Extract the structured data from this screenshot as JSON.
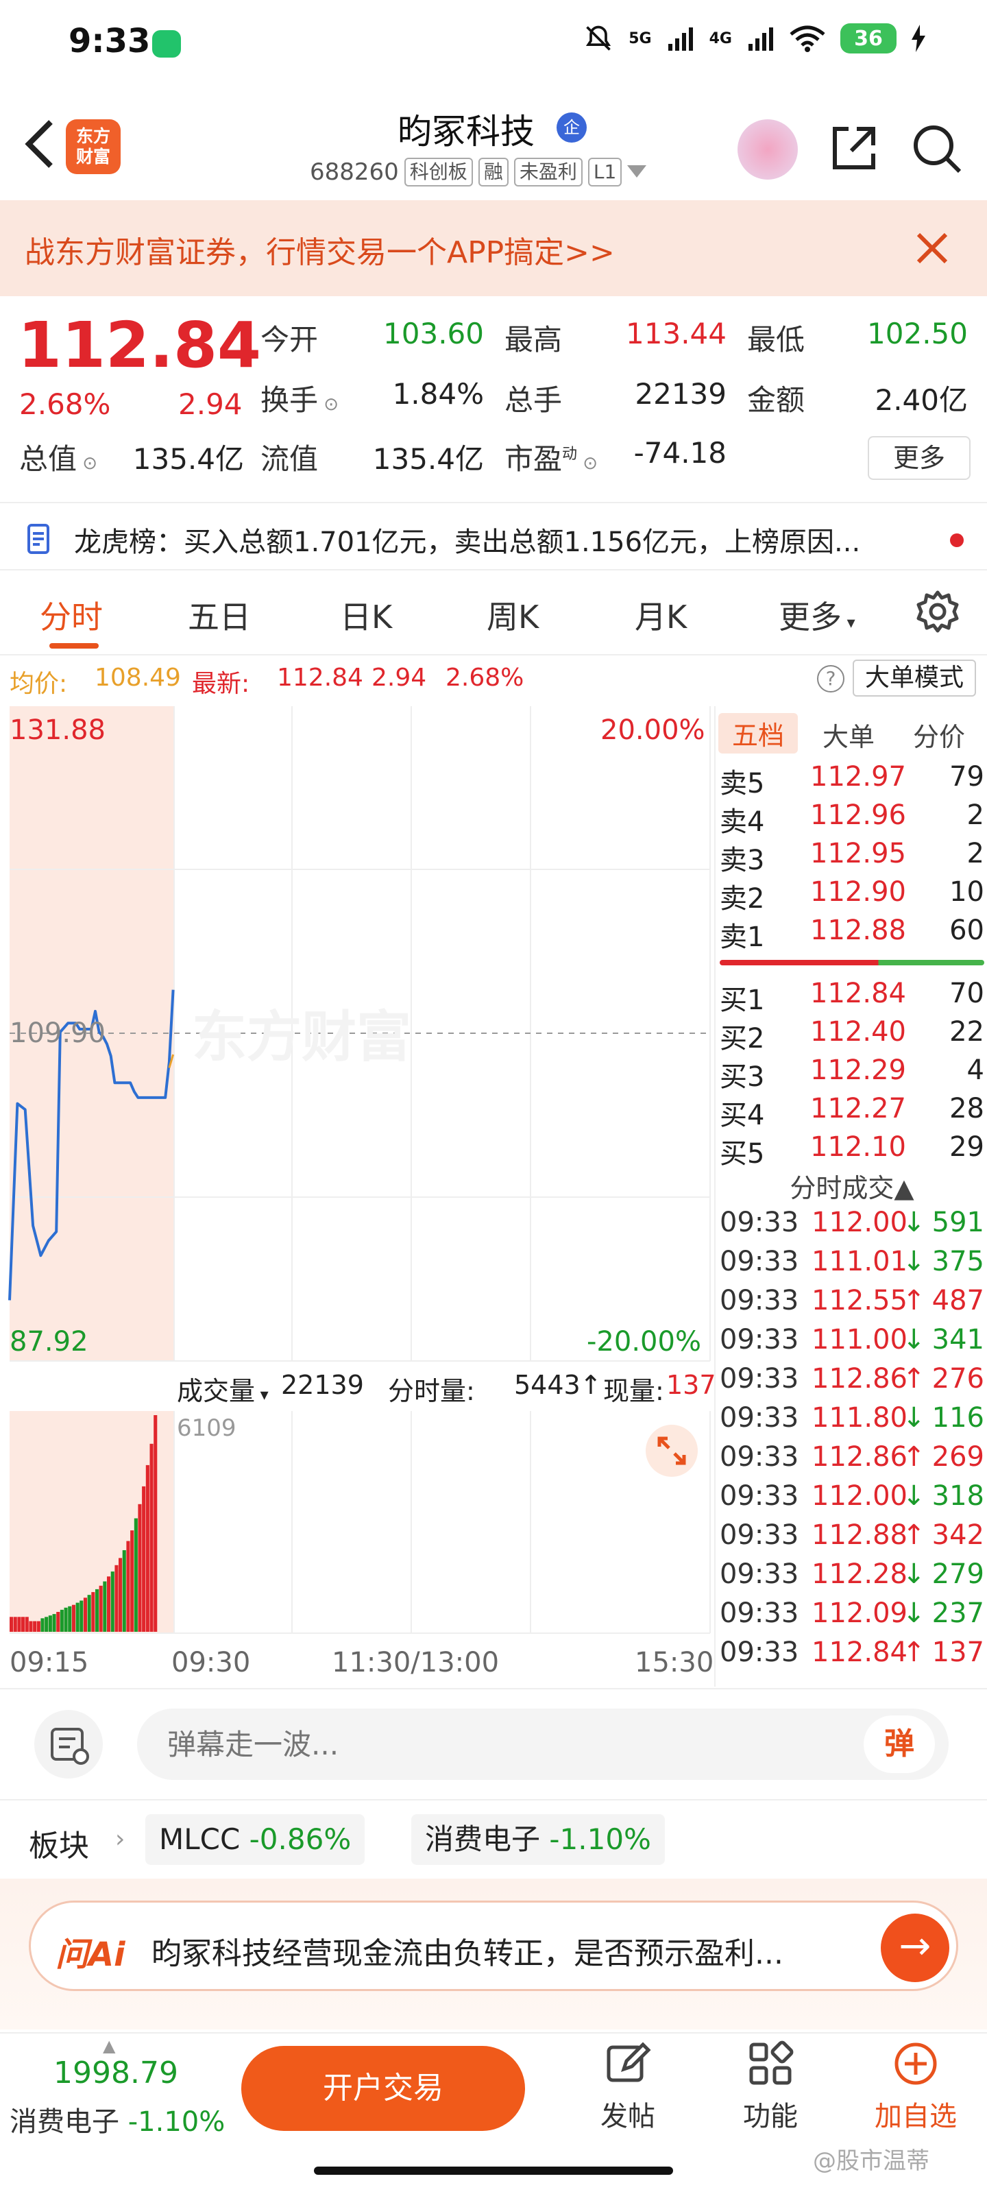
{
  "status": {
    "time": "9:33",
    "signal_5g": "5G",
    "signal_4g": "4G",
    "battery": "36"
  },
  "header": {
    "logo_line1": "东方",
    "logo_line2": "财富",
    "title": "昀冢科技",
    "qi_badge": "企",
    "code": "688260",
    "tags": [
      "科创板",
      "融",
      "未盈利",
      "L1"
    ]
  },
  "promo": {
    "text": "战东方财富证券，行情交易一个APP搞定>>"
  },
  "quote": {
    "last": "112.84",
    "change_pct": "2.68%",
    "change_amt": "2.94",
    "open_label": "今开",
    "open": "103.60",
    "high_label": "最高",
    "high": "113.44",
    "low_label": "最低",
    "low": "102.50",
    "turnover_label": "换手",
    "turnover": "1.84%",
    "volume_label": "总手",
    "volume": "22139",
    "amount_label": "金额",
    "amount": "2.40亿",
    "mktcap_label": "总值",
    "mktcap": "135.4亿",
    "float_label": "流值",
    "float": "135.4亿",
    "pe_label": "市盈",
    "pe_sup": "动",
    "pe": "-74.18",
    "more": "更多"
  },
  "dragon": {
    "text": "龙虎榜：买入总额1.701亿元，卖出总额1.156亿元，上榜原因..."
  },
  "tabs": [
    "分时",
    "五日",
    "日K",
    "周K",
    "月K",
    "更多"
  ],
  "info_line": {
    "avg_label": "均价:",
    "avg": "108.49",
    "latest_label": "最新:",
    "latest": "112.84",
    "chg": "2.94",
    "pct": "2.68%",
    "help": "?",
    "big_order": "大单模式"
  },
  "chart_labels": {
    "top_price": "131.88",
    "top_pct": "20.00%",
    "mid_price": "109.90",
    "bottom_price": "87.92",
    "bottom_pct": "-20.00%",
    "watermark": "东方财富",
    "vol_max": "6109",
    "times": [
      "09:15",
      "09:30",
      "11:30/13:00",
      "15:30"
    ]
  },
  "volume_bar": {
    "vol_label": "成交量",
    "vol": "22139",
    "minute_label": "分时量:",
    "minute": "5443",
    "now_label": "现量:",
    "now": "137"
  },
  "chart_data": {
    "type": "line",
    "ylim": [
      87.92,
      131.88
    ],
    "price_x": [
      0,
      2,
      3,
      4,
      6,
      8,
      10,
      12,
      13,
      15,
      16,
      17,
      18,
      19,
      20,
      21,
      22,
      23,
      24,
      25,
      26,
      27,
      28,
      29,
      30,
      31,
      32,
      33,
      34,
      35,
      36,
      37,
      38,
      39,
      40,
      41,
      42
    ],
    "price_y": [
      92.0,
      105.2,
      105.0,
      104.8,
      97.0,
      95.0,
      96.0,
      96.6,
      110.0,
      110.6,
      110.6,
      110.6,
      110.2,
      110.2,
      110.2,
      110.2,
      111.4,
      110.0,
      109.7,
      109.2,
      108.4,
      106.6,
      106.6,
      106.6,
      106.6,
      106.6,
      106.0,
      105.6,
      105.6,
      105.6,
      105.6,
      105.6,
      105.6,
      105.6,
      105.6,
      108.0,
      112.84
    ],
    "avg_x": [
      41,
      42
    ],
    "avg_y": [
      107.6,
      108.49
    ],
    "volume": [
      {
        "x": 0,
        "v": 420,
        "c": "red"
      },
      {
        "x": 1,
        "v": 420,
        "c": "red"
      },
      {
        "x": 2,
        "v": 420,
        "c": "red"
      },
      {
        "x": 3,
        "v": 420,
        "c": "red"
      },
      {
        "x": 4,
        "v": 420,
        "c": "red"
      },
      {
        "x": 5,
        "v": 300,
        "c": "red"
      },
      {
        "x": 6,
        "v": 300,
        "c": "red"
      },
      {
        "x": 7,
        "v": 300,
        "c": "red"
      },
      {
        "x": 8,
        "v": 380,
        "c": "green"
      },
      {
        "x": 9,
        "v": 420,
        "c": "green"
      },
      {
        "x": 10,
        "v": 460,
        "c": "green"
      },
      {
        "x": 11,
        "v": 500,
        "c": "green"
      },
      {
        "x": 12,
        "v": 560,
        "c": "red"
      },
      {
        "x": 13,
        "v": 620,
        "c": "green"
      },
      {
        "x": 14,
        "v": 680,
        "c": "green"
      },
      {
        "x": 15,
        "v": 720,
        "c": "green"
      },
      {
        "x": 16,
        "v": 760,
        "c": "red"
      },
      {
        "x": 17,
        "v": 820,
        "c": "green"
      },
      {
        "x": 18,
        "v": 880,
        "c": "green"
      },
      {
        "x": 19,
        "v": 960,
        "c": "red"
      },
      {
        "x": 20,
        "v": 1040,
        "c": "green"
      },
      {
        "x": 21,
        "v": 1120,
        "c": "red"
      },
      {
        "x": 22,
        "v": 1200,
        "c": "green"
      },
      {
        "x": 23,
        "v": 1300,
        "c": "red"
      },
      {
        "x": 24,
        "v": 1420,
        "c": "green"
      },
      {
        "x": 25,
        "v": 1560,
        "c": "red"
      },
      {
        "x": 26,
        "v": 1700,
        "c": "green"
      },
      {
        "x": 27,
        "v": 1880,
        "c": "red"
      },
      {
        "x": 28,
        "v": 2080,
        "c": "red"
      },
      {
        "x": 29,
        "v": 2300,
        "c": "green"
      },
      {
        "x": 30,
        "v": 2560,
        "c": "red"
      },
      {
        "x": 31,
        "v": 2860,
        "c": "red"
      },
      {
        "x": 32,
        "v": 3200,
        "c": "green"
      },
      {
        "x": 33,
        "v": 3600,
        "c": "red"
      },
      {
        "x": 34,
        "v": 4100,
        "c": "red"
      },
      {
        "x": 35,
        "v": 4700,
        "c": "red"
      },
      {
        "x": 36,
        "v": 5300,
        "c": "red"
      },
      {
        "x": 37,
        "v": 6109,
        "c": "red"
      }
    ],
    "vol_max": 6109
  },
  "order_book": {
    "tabs": [
      "五档",
      "大单",
      "分价"
    ],
    "asks": [
      {
        "label": "卖5",
        "price": "112.97",
        "qty": "79"
      },
      {
        "label": "卖4",
        "price": "112.96",
        "qty": "2"
      },
      {
        "label": "卖3",
        "price": "112.95",
        "qty": "2"
      },
      {
        "label": "卖2",
        "price": "112.90",
        "qty": "10"
      },
      {
        "label": "卖1",
        "price": "112.88",
        "qty": "60"
      }
    ],
    "bids": [
      {
        "label": "买1",
        "price": "112.84",
        "qty": "70"
      },
      {
        "label": "买2",
        "price": "112.40",
        "qty": "22"
      },
      {
        "label": "买3",
        "price": "112.29",
        "qty": "4"
      },
      {
        "label": "买4",
        "price": "112.27",
        "qty": "28"
      },
      {
        "label": "买5",
        "price": "112.10",
        "qty": "29"
      }
    ],
    "trades_title": "分时成交▲",
    "trades": [
      {
        "t": "09:33",
        "p": "112.00",
        "d": "↓",
        "v": "591",
        "c": "red"
      },
      {
        "t": "09:33",
        "p": "111.01",
        "d": "↓",
        "v": "375",
        "c": "red"
      },
      {
        "t": "09:33",
        "p": "112.55",
        "d": "↑",
        "v": "487",
        "c": "red"
      },
      {
        "t": "09:33",
        "p": "111.00",
        "d": "↓",
        "v": "341",
        "c": "red"
      },
      {
        "t": "09:33",
        "p": "112.86",
        "d": "↑",
        "v": "276",
        "c": "red"
      },
      {
        "t": "09:33",
        "p": "111.80",
        "d": "↓",
        "v": "116",
        "c": "red"
      },
      {
        "t": "09:33",
        "p": "112.86",
        "d": "↑",
        "v": "269",
        "c": "red"
      },
      {
        "t": "09:33",
        "p": "112.00",
        "d": "↓",
        "v": "318",
        "c": "red"
      },
      {
        "t": "09:33",
        "p": "112.88",
        "d": "↑",
        "v": "342",
        "c": "red"
      },
      {
        "t": "09:33",
        "p": "112.28",
        "d": "↓",
        "v": "279",
        "c": "red"
      },
      {
        "t": "09:33",
        "p": "112.09",
        "d": "↓",
        "v": "237",
        "c": "red"
      },
      {
        "t": "09:33",
        "p": "112.84",
        "d": "↑",
        "v": "137",
        "c": "red"
      }
    ]
  },
  "danmaku": {
    "placeholder": "弹幕走一波...",
    "btn": "弹"
  },
  "sector": {
    "label": "板块",
    "items": [
      {
        "name": "MLCC",
        "pct": "-0.86%"
      },
      {
        "name": "消费电子",
        "pct": "-1.10%"
      }
    ]
  },
  "ai": {
    "logo": "问Ai",
    "text": "昀冢科技经营现金流由负转正，是否预示盈利..."
  },
  "bottom": {
    "index_value": "1998.79",
    "index_name": "消费电子",
    "index_pct": "-1.10%",
    "trade_btn": "开户交易",
    "nav": [
      "发帖",
      "功能",
      "加自选"
    ],
    "watermark": "@股市温蒂"
  },
  "colors": {
    "up": "#e0262c",
    "down": "#1a9a2a",
    "accent": "#e8521c",
    "line": "#2d6fd2",
    "avg": "#e8a02a"
  }
}
